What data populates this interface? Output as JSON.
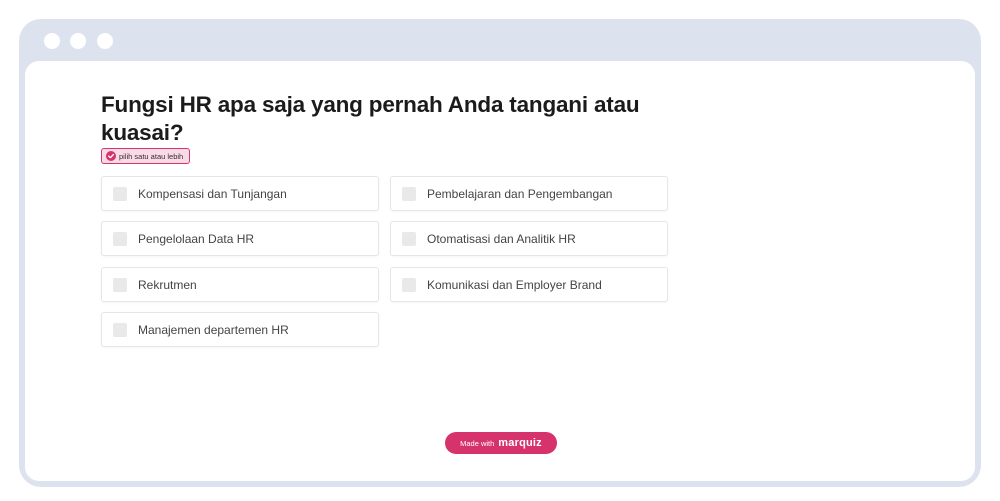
{
  "question": {
    "title": "Fungsi HR apa saja yang pernah Anda tangani atau kuasai?",
    "hint": "pilih satu atau lebih"
  },
  "options": [
    {
      "label": "Kompensasi dan Tunjangan",
      "checked": false
    },
    {
      "label": "Pembelajaran dan Pengembangan",
      "checked": false
    },
    {
      "label": "Pengelolaan Data HR",
      "checked": false
    },
    {
      "label": "Otomatisasi dan Analitik HR",
      "checked": false
    },
    {
      "label": "Rekrutmen",
      "checked": false
    },
    {
      "label": "Komunikasi dan Employer Brand",
      "checked": false
    },
    {
      "label": "Manajemen departemen HR",
      "checked": false
    }
  ],
  "footer": {
    "made_with": "Made with",
    "brand": "marquiz"
  },
  "colors": {
    "accent": "#d6336c",
    "frame": "#dde3ee",
    "hint_bg": "#f9dbe7"
  },
  "icons": {
    "hint": "check-circle-icon"
  }
}
